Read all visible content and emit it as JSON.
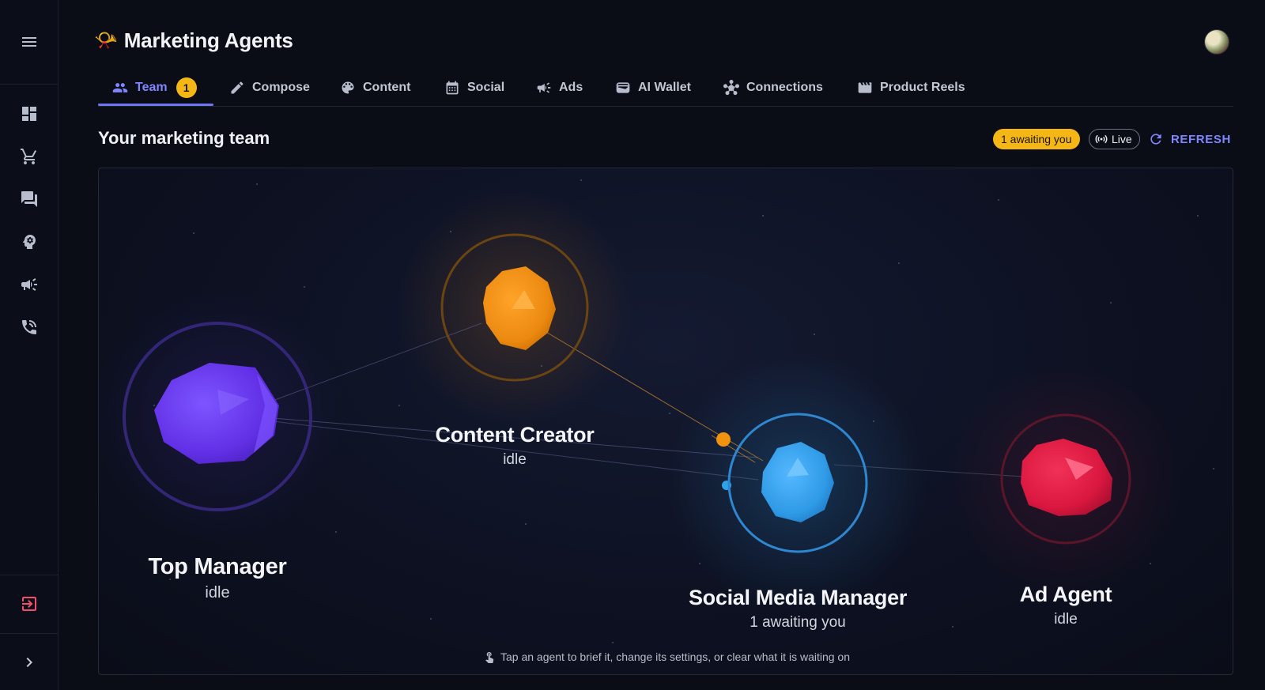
{
  "app": {
    "title_emoji": "📯",
    "title": "Marketing Agents"
  },
  "sidebar": {
    "items": [
      {
        "icon": "menu-icon"
      },
      {
        "icon": "dashboard-icon"
      },
      {
        "icon": "cart-icon"
      },
      {
        "icon": "chat-icon"
      },
      {
        "icon": "brain-gear-icon"
      },
      {
        "icon": "megaphone-icon"
      },
      {
        "icon": "phone-call-icon"
      },
      {
        "icon": "logout-icon"
      },
      {
        "icon": "chevron-right-icon"
      }
    ]
  },
  "tabs": [
    {
      "label": "Team",
      "icon": "people-icon",
      "badge": "1",
      "active": true
    },
    {
      "label": "Compose",
      "icon": "pencil-icon"
    },
    {
      "label": "Content",
      "icon": "palette-icon"
    },
    {
      "label": "Social",
      "icon": "calendar-icon"
    },
    {
      "label": "Ads",
      "icon": "megaphone-icon"
    },
    {
      "label": "AI Wallet",
      "icon": "wallet-icon"
    },
    {
      "label": "Connections",
      "icon": "hub-icon"
    },
    {
      "label": "Product Reels",
      "icon": "clapperboard-icon"
    }
  ],
  "section": {
    "title": "Your marketing team",
    "awaiting_chip": "1 awaiting you",
    "live_chip": "Live",
    "refresh_label": "REFRESH"
  },
  "agents": [
    {
      "name": "Top Manager",
      "status": "idle",
      "color": "#6b3cf0"
    },
    {
      "name": "Content Creator",
      "status": "idle",
      "color": "#f08a12"
    },
    {
      "name": "Social Media Manager",
      "status": "1 awaiting you",
      "color": "#2fa3ea"
    },
    {
      "name": "Ad Agent",
      "status": "idle",
      "color": "#e21d47"
    }
  ],
  "hint": "Tap an agent to brief it, change its settings, or clear what it is waiting on",
  "colors": {
    "accent": "#7f86ff",
    "badge": "#f5b715",
    "danger": "#f0506e"
  }
}
